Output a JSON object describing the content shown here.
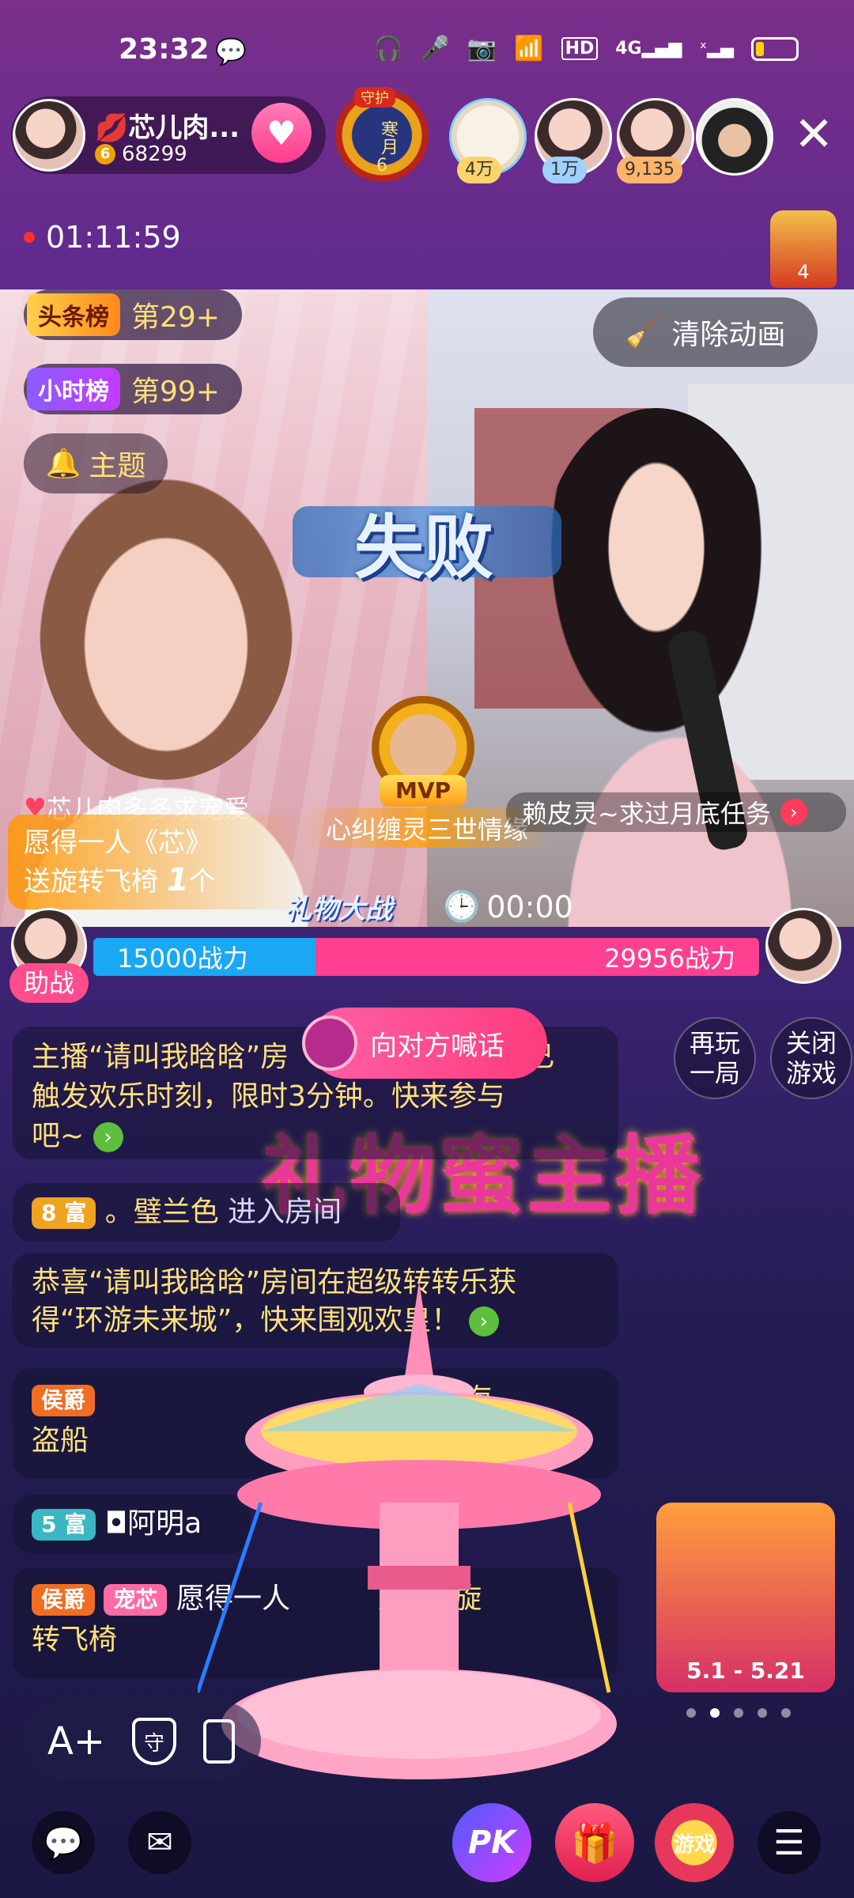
{
  "status_bar": {
    "time": "23:32",
    "icons": [
      "wechat-icon",
      "headset-icon",
      "mic-icon",
      "camera-icon",
      "wifi-icon",
      "hd-icon",
      "4g-signal-icon",
      "signal-x-icon",
      "battery-icon"
    ],
    "hd": "HD",
    "network": "4G",
    "battery_level": 0.2
  },
  "host": {
    "name": "芯儿肉...",
    "fan_level": "6",
    "followers": "68299"
  },
  "guard_badge": {
    "top_label": "守护",
    "label": "寒月",
    "level": "6"
  },
  "viewers": [
    {
      "count": "4万",
      "color": "#ffd36a"
    },
    {
      "count": "1万",
      "color": "#9fd0ff"
    },
    {
      "count": "9,135",
      "color": "#ffb36b"
    },
    {
      "count": "",
      "color": ""
    }
  ],
  "live_timer": "01:11:59",
  "chair_badge_count": "4",
  "ranks": {
    "headline": {
      "tag": "头条榜",
      "rank": "第29+"
    },
    "hourly": {
      "tag": "小时榜",
      "rank": "第99+"
    }
  },
  "theme_button": "主题",
  "clear_anim_button": "清除动画",
  "result_banner": "失败",
  "mvp": {
    "label": "MVP",
    "name": "心纠缠灵三世情缘"
  },
  "left_anchor_title": "芯儿肉多多求宠爱",
  "right_anchor_title": "赖皮灵~求过月底任务",
  "gift_notice": {
    "line1": "愿得一人《芯》",
    "line2": "送旋转飞椅",
    "count": "1",
    "unit": "个"
  },
  "battle": {
    "title": "礼物大战",
    "timer": "00:00"
  },
  "power": {
    "left_value": 15000,
    "left_label": "15000战力",
    "right_value": 29956,
    "right_label": "29956战力"
  },
  "assist_label": "助战",
  "shout_button": "向对方喊话",
  "replay_button": [
    "再玩",
    "一局"
  ],
  "close_game_button": [
    "关闭",
    "游戏"
  ],
  "big_title": "礼物蜜主播",
  "chat": [
    {
      "type": "system",
      "text1": "主播“请叫我晗晗”房",
      "text2": "已",
      "line2": "触发欢乐时刻，限时3分钟。快来参与",
      "line3": "吧~"
    },
    {
      "type": "enter",
      "tag": "8 富",
      "user": "。璧兰色",
      "action": "进入房间"
    },
    {
      "type": "system2",
      "line1": "恭喜“请叫我晗晗”房间在超级转转乐获",
      "line2": "得“环游未来城”，快来围观欢皇！"
    },
    {
      "type": "gift",
      "tag": "侯爵",
      "action": "送1个海",
      "line2": "盗船"
    },
    {
      "type": "enter2",
      "tag": "5 富",
      "user": "◘阿明a"
    },
    {
      "type": "gift2",
      "tag": "侯爵",
      "sub_tag": "宠芯",
      "user": "愿得一人",
      "action": "送1个旋",
      "line2": "转飞椅"
    }
  ],
  "promo_dates": "5.1 - 5.21",
  "carousel_pages": 5,
  "carousel_active": 1,
  "tools": {
    "font": "A+",
    "guard": "守"
  },
  "bottom_bar": {
    "chat_icon": "chat-bubble-icon",
    "mail_icon": "mail-icon",
    "pk_label": "PK",
    "gift_icon": "gift-icon",
    "game_label": "游戏",
    "menu_icon": "menu-icon"
  }
}
